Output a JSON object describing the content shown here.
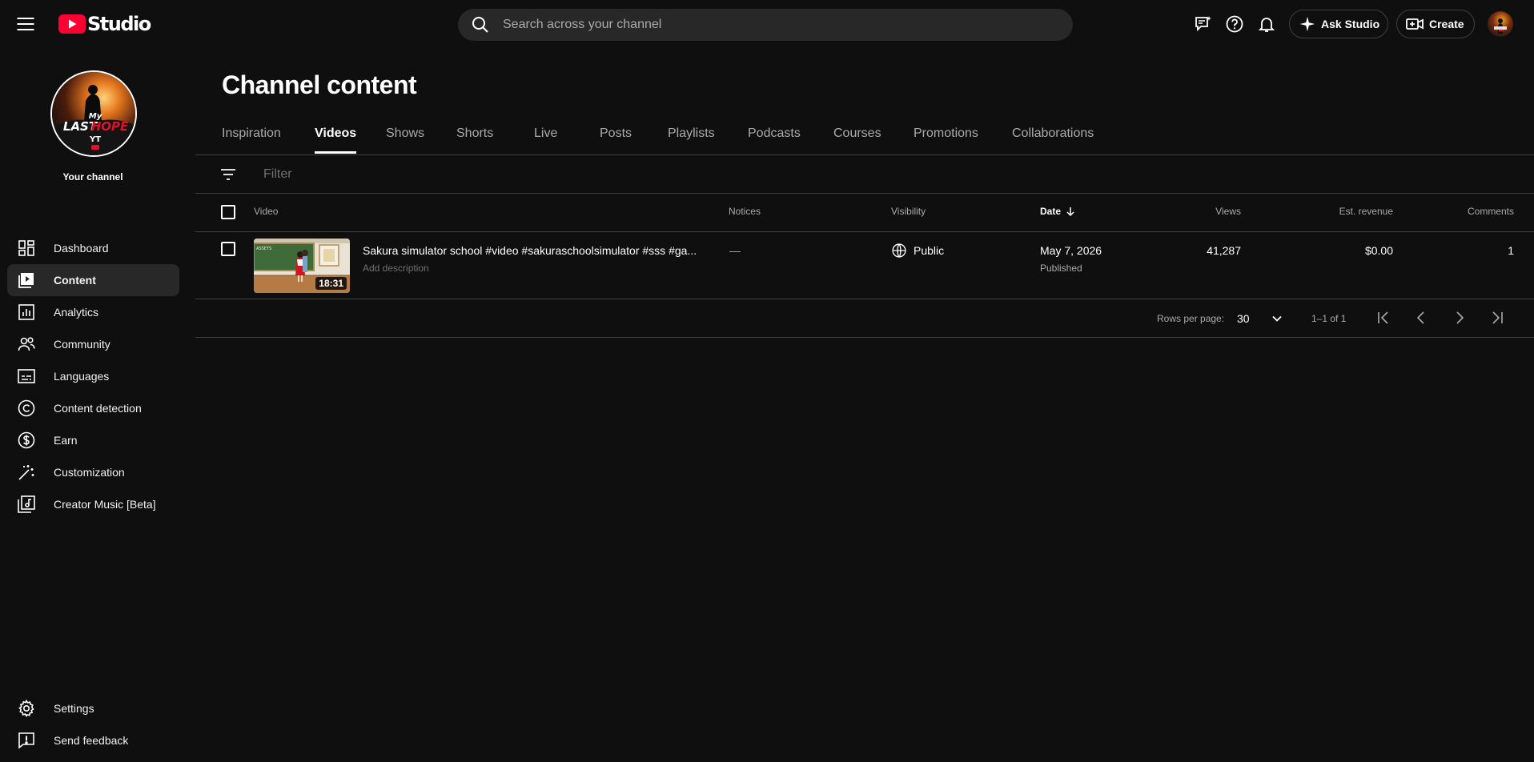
{
  "header": {
    "logo_text": "Studio",
    "search_placeholder": "Search across your channel",
    "ask_studio_label": "Ask Studio",
    "create_label": "Create"
  },
  "sidebar": {
    "channel_label": "Your channel",
    "avatar_text": {
      "line1": "My",
      "line2a": "LAST",
      "line2b": "HOPE",
      "line3": "YT"
    },
    "items": [
      {
        "label": "Dashboard",
        "icon": "dashboard-icon"
      },
      {
        "label": "Content",
        "icon": "content-icon",
        "active": true
      },
      {
        "label": "Analytics",
        "icon": "analytics-icon"
      },
      {
        "label": "Community",
        "icon": "community-icon"
      },
      {
        "label": "Languages",
        "icon": "subtitles-icon"
      },
      {
        "label": "Content detection",
        "icon": "copyright-icon"
      },
      {
        "label": "Earn",
        "icon": "dollar-icon"
      },
      {
        "label": "Customization",
        "icon": "magic-wand-icon"
      },
      {
        "label": "Creator Music [Beta]",
        "icon": "music-library-icon"
      }
    ],
    "footer": [
      {
        "label": "Settings",
        "icon": "gear-icon"
      },
      {
        "label": "Send feedback",
        "icon": "feedback-icon"
      }
    ]
  },
  "main": {
    "title": "Channel content",
    "tabs": [
      "Inspiration",
      "Videos",
      "Shows",
      "Shorts",
      "Live",
      "Posts",
      "Playlists",
      "Podcasts",
      "Courses",
      "Promotions",
      "Collaborations"
    ],
    "active_tab": "Videos",
    "filter_placeholder": "Filter",
    "columns": {
      "video": "Video",
      "notices": "Notices",
      "visibility": "Visibility",
      "date": "Date",
      "views": "Views",
      "revenue": "Est. revenue",
      "comments": "Comments"
    },
    "rows": [
      {
        "title": "Sakura simulator school #video #sakuraschoolsimulator #sss #ga...",
        "description": "Add description",
        "duration": "18:31",
        "notices": "—",
        "visibility": "Public",
        "date": "May 7, 2026",
        "status": "Published",
        "views": "41,287",
        "revenue": "$0.00",
        "comments": "1"
      }
    ],
    "pagination": {
      "rows_per_page_label": "Rows per page:",
      "rows_per_page": "30",
      "range": "1–1 of 1"
    }
  },
  "colors": {
    "background": "#0f0f0f",
    "surface": "#282828",
    "brand_red": "#ff0033",
    "divider": "#3f3f3f"
  }
}
